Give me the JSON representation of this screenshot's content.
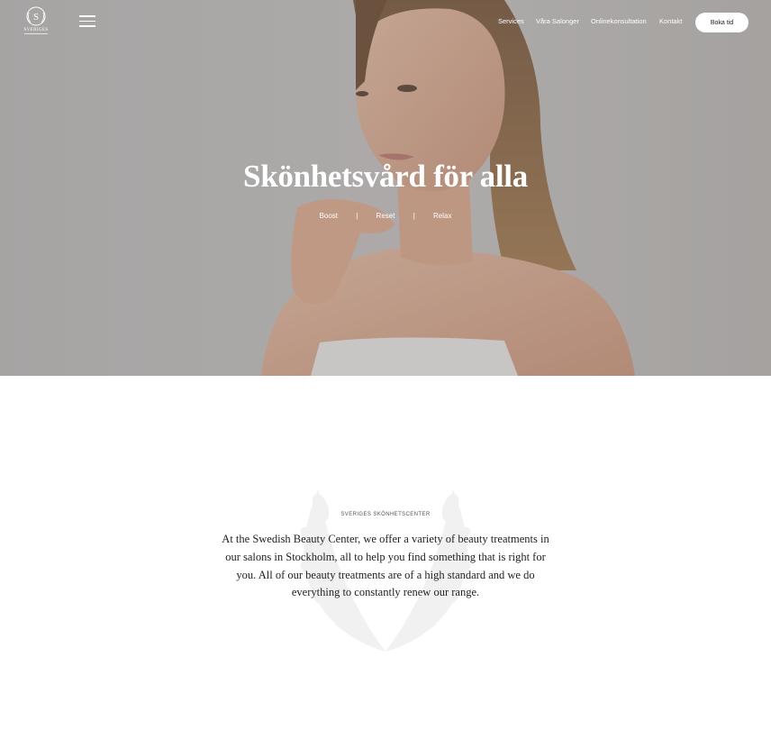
{
  "header": {
    "logo_text": "SVERIGES",
    "logo_monogram": "S",
    "menu_icon": "hamburger-icon",
    "nav": [
      {
        "label": "Services"
      },
      {
        "label": "Våra Salonger"
      },
      {
        "label": "Onlinekonsultation"
      },
      {
        "label": "Kontakt"
      }
    ],
    "book_label": "Boka tid"
  },
  "hero": {
    "title": "Skönhetsvård för alla",
    "tags": [
      "Boost",
      "|",
      "Reset",
      "|",
      "Relax"
    ]
  },
  "about": {
    "eyebrow": "SVERIGES SKÖNHETSCENTER",
    "text": "At the Swedish Beauty Center, we offer a variety of beauty treatments in our salons in Stockholm, all to help you find something that is right for you. All of our beauty treatments are of a high standard and we do everything to constantly renew our range.",
    "decoration_icon": "laurel-wreath-icon"
  },
  "colors": {
    "text": "#222222",
    "white": "#ffffff"
  }
}
